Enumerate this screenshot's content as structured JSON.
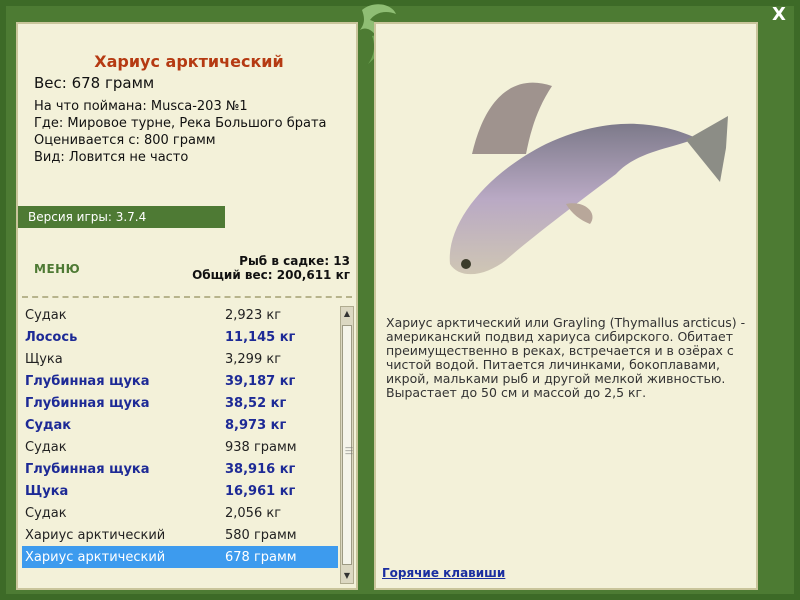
{
  "fish_card": {
    "title": "Хариус арктический",
    "weight": "Вес: 678 грамм",
    "bait": "На что поймана: Musca-203 №1",
    "place": "Где: Мировое турне, Река Большого брата",
    "value": "Оценивается с: 800 грамм",
    "kind": "Вид: Ловится не часто"
  },
  "version": "Версия игры: 3.7.4",
  "menu_label": "МЕНЮ",
  "stats": {
    "count": "Рыб в садке: 13",
    "total": "Общий вес: 200,611 кг"
  },
  "catch_list": [
    {
      "name": "Судак",
      "weight": "2,923 кг",
      "bold": false
    },
    {
      "name": "Лосось",
      "weight": "11,145 кг",
      "bold": true
    },
    {
      "name": "Щука",
      "weight": "3,299 кг",
      "bold": false
    },
    {
      "name": "Глубинная щука",
      "weight": "39,187 кг",
      "bold": true
    },
    {
      "name": "Глубинная щука",
      "weight": "38,52 кг",
      "bold": true
    },
    {
      "name": "Судак",
      "weight": "8,973 кг",
      "bold": true
    },
    {
      "name": "Судак",
      "weight": "938 грамм",
      "bold": false
    },
    {
      "name": "Глубинная щука",
      "weight": "38,916 кг",
      "bold": true
    },
    {
      "name": "Щука",
      "weight": "16,961 кг",
      "bold": true
    },
    {
      "name": "Судак",
      "weight": "2,056 кг",
      "bold": false
    },
    {
      "name": "Хариус арктический",
      "weight": "580 грамм",
      "bold": false
    },
    {
      "name": "Хариус арктический",
      "weight": "678 грамм",
      "bold": false,
      "selected": true
    }
  ],
  "description": "Хариус арктический или Grayling (Thymallus arcticus) - американский подвид хариуса сибирского. Обитает преимущественно в реках, встречается и в озёрах с чистой водой. Питается личинками, бокоплавами, икрой, мальками рыб и другой мелкой живностью. Вырастает до 50 см и массой до 2,5 кг.",
  "hotkeys_label": "Горячие клавиши",
  "close_label": "X",
  "colors": {
    "frame": "#4d7b33",
    "title": "#b53a12",
    "selected": "#3d9bee",
    "bold": "#1d2a96"
  }
}
